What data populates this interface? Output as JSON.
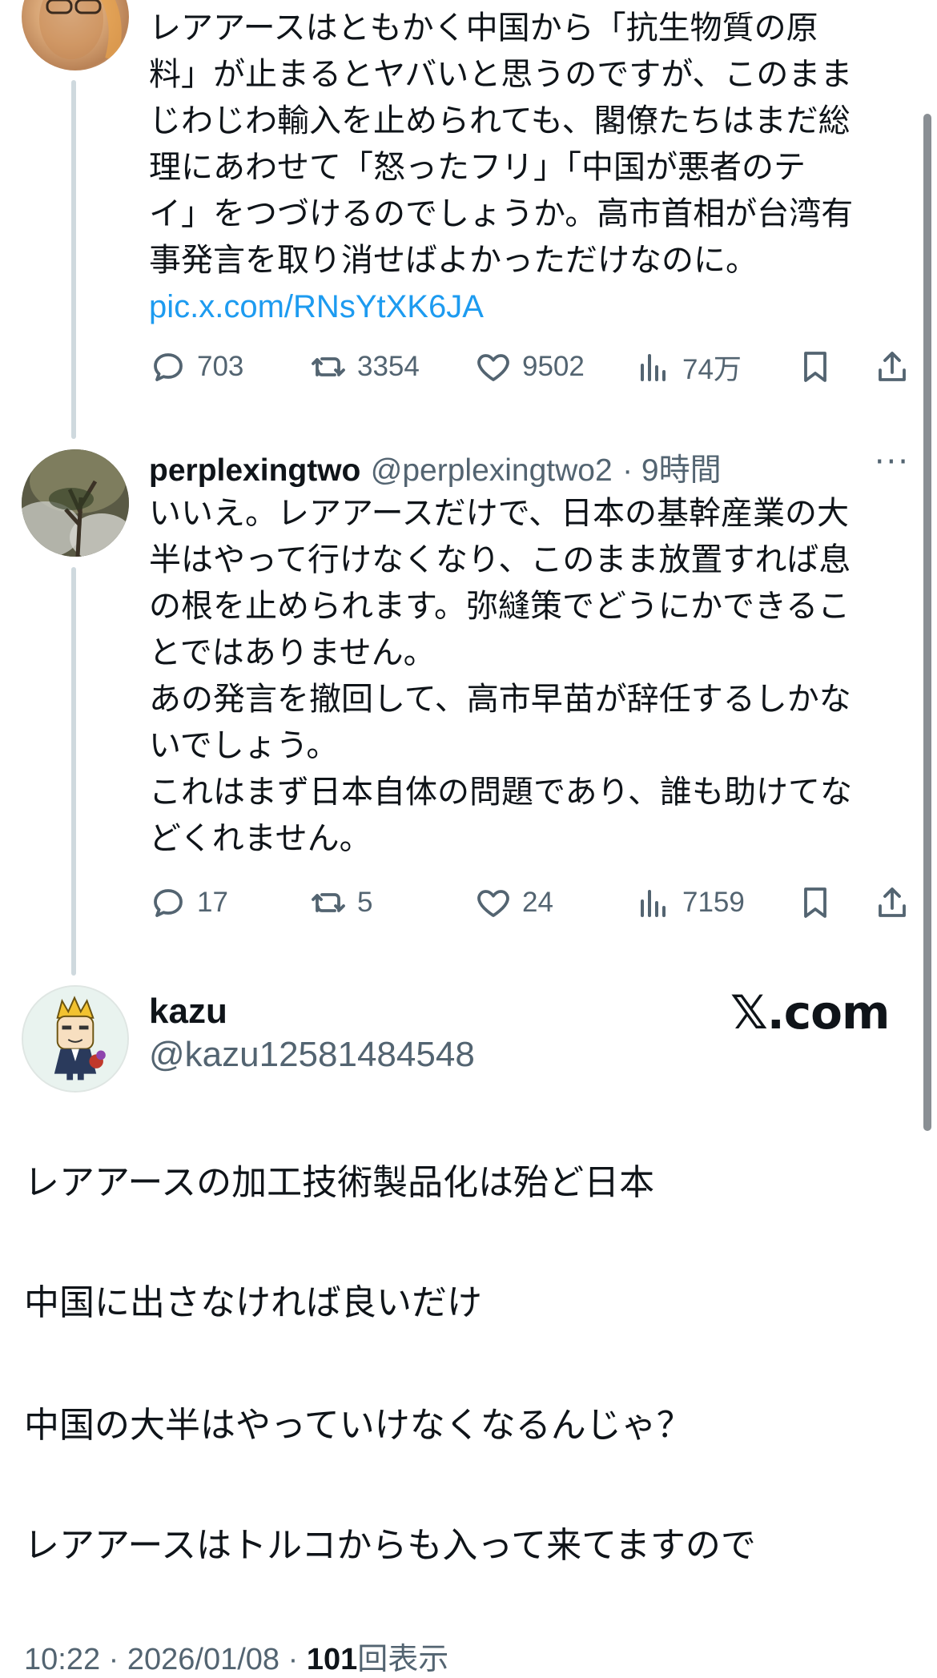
{
  "tweet1": {
    "text_lines": [
      "レアアースはともかく中国から「抗生物質の原",
      "料」が止まるとヤバいと思うのですが、このまま",
      "じわじわ輸入を止められても、閣僚たちはまだ総",
      "理にあわせて「怒ったフリ」「中国が悪者のテ",
      "イ」をつづけるのでしょうか。高市首相が台湾有",
      "事発言を取り消せばよかっただけなのに。"
    ],
    "link": "pic.x.com/RNsYtXK6JA",
    "replies": "703",
    "reposts": "3354",
    "likes": "9502",
    "views": "74万"
  },
  "tweet2": {
    "name": "perplexingtwo",
    "handle": "@perplexingtwo2",
    "time": "· 9時間",
    "more": "···",
    "text_lines": [
      "いいえ。レアアースだけで、日本の基幹産業の大",
      "半はやって行けなくなり、このまま放置すれば息",
      "の根を止められます。弥縫策でどうにかできるこ",
      "とではありません。",
      "あの発言を撤回して、高市早苗が辞任するしかな",
      "いでしょう。",
      "これはまず日本自体の問題であり、誰も助けてな",
      "どくれません。"
    ],
    "replies": "17",
    "reposts": "5",
    "likes": "24",
    "views": "7159"
  },
  "main_post": {
    "name": "kazu",
    "handle": "@kazu12581484548",
    "watermark": "𝕏.com",
    "paragraphs": [
      "レアアースの加工技術製品化は殆ど日本",
      "中国に出さなければ良いだけ",
      "中国の大半はやっていけなくなるんじゃ？",
      "レアアースはトルコからも入って来てますので"
    ],
    "timestamp": "10:22 · 2026/01/08 · ",
    "view_count": "101",
    "view_label": "回表示"
  },
  "colors": {
    "text": "#0f1419",
    "muted": "#536471",
    "link": "#1d9bf0",
    "thread_line": "#cfd9de"
  }
}
